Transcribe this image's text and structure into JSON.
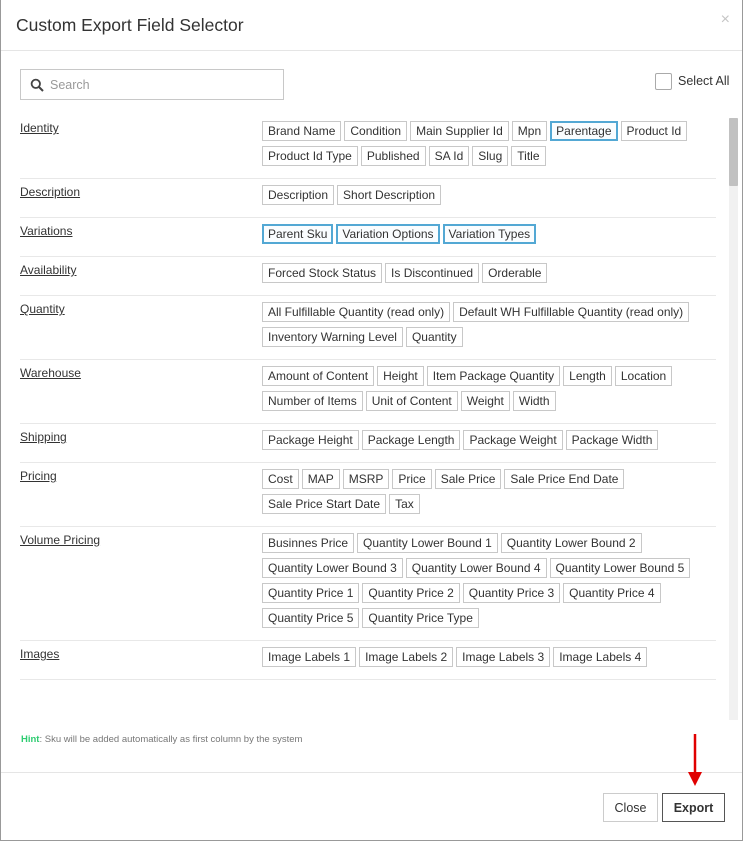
{
  "dialog": {
    "title": "Custom Export Field Selector",
    "close_icon": "×"
  },
  "search": {
    "placeholder": "Search",
    "value": ""
  },
  "select_all": {
    "label": "Select All",
    "checked": false
  },
  "groups": [
    {
      "label": "Identity",
      "fields": [
        {
          "label": "Brand Name",
          "selected": false
        },
        {
          "label": "Condition",
          "selected": false
        },
        {
          "label": "Main Supplier Id",
          "selected": false
        },
        {
          "label": "Mpn",
          "selected": false
        },
        {
          "label": "Parentage",
          "selected": true
        },
        {
          "label": "Product Id",
          "selected": false
        },
        {
          "label": "Product Id Type",
          "selected": false
        },
        {
          "label": "Published",
          "selected": false
        },
        {
          "label": "SA Id",
          "selected": false
        },
        {
          "label": "Slug",
          "selected": false
        },
        {
          "label": "Title",
          "selected": false
        }
      ]
    },
    {
      "label": "Description",
      "fields": [
        {
          "label": "Description",
          "selected": false
        },
        {
          "label": "Short Description",
          "selected": false
        }
      ]
    },
    {
      "label": "Variations",
      "fields": [
        {
          "label": "Parent Sku",
          "selected": true
        },
        {
          "label": "Variation Options",
          "selected": true
        },
        {
          "label": "Variation Types",
          "selected": true
        }
      ]
    },
    {
      "label": "Availability",
      "fields": [
        {
          "label": "Forced Stock Status",
          "selected": false
        },
        {
          "label": "Is Discontinued",
          "selected": false
        },
        {
          "label": "Orderable",
          "selected": false
        }
      ]
    },
    {
      "label": "Quantity",
      "fields": [
        {
          "label": "All Fulfillable Quantity (read only)",
          "selected": false
        },
        {
          "label": "Default WH Fulfillable Quantity (read only)",
          "selected": false
        },
        {
          "label": "Inventory Warning Level",
          "selected": false
        },
        {
          "label": "Quantity",
          "selected": false
        }
      ]
    },
    {
      "label": "Warehouse",
      "fields": [
        {
          "label": "Amount of Content",
          "selected": false
        },
        {
          "label": "Height",
          "selected": false
        },
        {
          "label": "Item Package Quantity",
          "selected": false
        },
        {
          "label": "Length",
          "selected": false
        },
        {
          "label": "Location",
          "selected": false
        },
        {
          "label": "Number of Items",
          "selected": false
        },
        {
          "label": "Unit of Content",
          "selected": false
        },
        {
          "label": "Weight",
          "selected": false
        },
        {
          "label": "Width",
          "selected": false
        }
      ]
    },
    {
      "label": "Shipping",
      "fields": [
        {
          "label": "Package Height",
          "selected": false
        },
        {
          "label": "Package Length",
          "selected": false
        },
        {
          "label": "Package Weight",
          "selected": false
        },
        {
          "label": "Package Width",
          "selected": false
        }
      ]
    },
    {
      "label": "Pricing",
      "fields": [
        {
          "label": "Cost",
          "selected": false
        },
        {
          "label": "MAP",
          "selected": false
        },
        {
          "label": "MSRP",
          "selected": false
        },
        {
          "label": "Price",
          "selected": false
        },
        {
          "label": "Sale Price",
          "selected": false
        },
        {
          "label": "Sale Price End Date",
          "selected": false
        },
        {
          "label": "Sale Price Start Date",
          "selected": false
        },
        {
          "label": "Tax",
          "selected": false
        }
      ]
    },
    {
      "label": "Volume Pricing",
      "fields": [
        {
          "label": "Businnes Price",
          "selected": false
        },
        {
          "label": "Quantity Lower Bound 1",
          "selected": false
        },
        {
          "label": "Quantity Lower Bound 2",
          "selected": false
        },
        {
          "label": "Quantity Lower Bound 3",
          "selected": false
        },
        {
          "label": "Quantity Lower Bound 4",
          "selected": false
        },
        {
          "label": "Quantity Lower Bound 5",
          "selected": false
        },
        {
          "label": "Quantity Price 1",
          "selected": false
        },
        {
          "label": "Quantity Price 2",
          "selected": false
        },
        {
          "label": "Quantity Price 3",
          "selected": false
        },
        {
          "label": "Quantity Price 4",
          "selected": false
        },
        {
          "label": "Quantity Price 5",
          "selected": false
        },
        {
          "label": "Quantity Price Type",
          "selected": false
        }
      ]
    },
    {
      "label": "Images",
      "fields": [
        {
          "label": "Image Labels 1",
          "selected": false
        },
        {
          "label": "Image Labels 2",
          "selected": false
        },
        {
          "label": "Image Labels 3",
          "selected": false
        },
        {
          "label": "Image Labels 4",
          "selected": false
        }
      ]
    }
  ],
  "hint": {
    "key": "Hint",
    "text": ": Sku will be added automatically as first column by the system"
  },
  "footer": {
    "close_label": "Close",
    "export_label": "Export"
  },
  "colors": {
    "selected_border": "#53a8d4",
    "hint_key": "#2ecc71",
    "annotation_arrow": "#e00000"
  },
  "icons": {
    "search": "search-icon",
    "close": "close-icon",
    "annotation": "red-arrow-icon"
  }
}
